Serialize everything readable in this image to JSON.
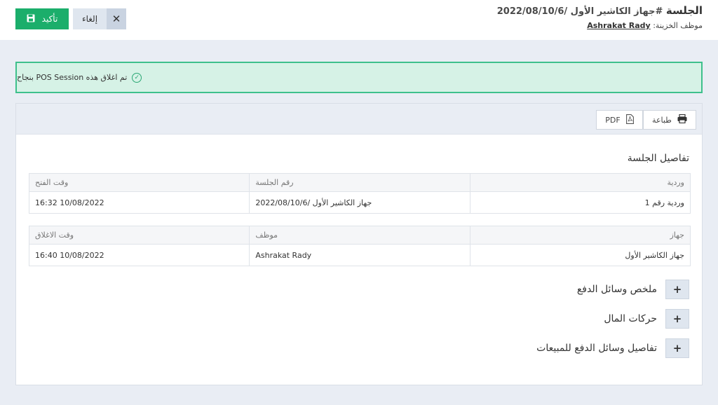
{
  "header": {
    "title_main": "الجلسة",
    "title_rest": " #جهاز الكاشير الأول /2022/08/10/6",
    "employee_label": "موظف الخزينة: ",
    "employee_name": "Ashrakat Rady",
    "confirm_label": "تأكيد",
    "cancel_label": "إلغاء"
  },
  "alert": {
    "text": "تم اغلاق هذه POS Session بنجاح"
  },
  "toolbar": {
    "print_label": "طباعة",
    "pdf_label": "PDF"
  },
  "details": {
    "title": "تفاصيل الجلسة",
    "table1": {
      "headers": [
        "وردية",
        "رقم الجلسة",
        "وقت الفتح"
      ],
      "values": [
        "وردية رقم 1",
        "جهاز الكاشير الأول /2022/08/10/6",
        "10/08/2022 16:32"
      ]
    },
    "table2": {
      "headers": [
        "جهاز",
        "موظف",
        "وقت الاغلاق"
      ],
      "values": [
        "جهاز الكاشير الأول",
        "Ashrakat Rady",
        "10/08/2022 16:40"
      ]
    }
  },
  "sections": [
    {
      "label": "ملخص وسائل الدفع"
    },
    {
      "label": "حركات المال"
    },
    {
      "label": "تفاصيل وسائل الدفع للمبيعات"
    }
  ],
  "colors": {
    "accent_green": "#1bae6b",
    "alert_bg": "#d6f2e6",
    "alert_border": "#3ec08c"
  },
  "icons": {
    "confirm": "save-icon",
    "cancel": "close-icon",
    "alert": "check-circle-icon",
    "print": "printer-icon",
    "pdf": "pdf-file-icon",
    "expand": "plus-icon"
  }
}
